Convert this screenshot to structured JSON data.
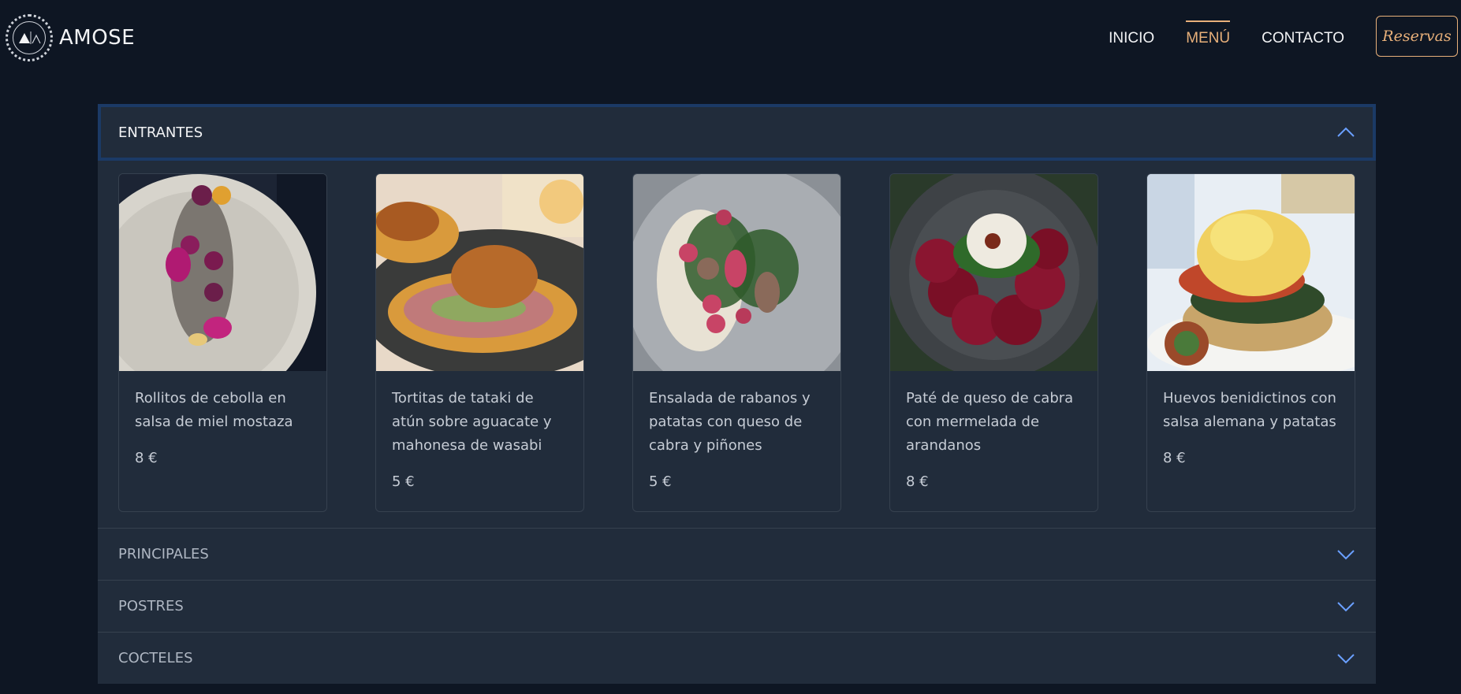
{
  "brand": {
    "name": "AMOSE"
  },
  "nav": {
    "links": [
      {
        "label": "INICIO",
        "active": false
      },
      {
        "label": "MENÚ",
        "active": true
      },
      {
        "label": "CONTACTO",
        "active": false
      }
    ],
    "reserve_label": "Reservas"
  },
  "colors": {
    "background": "#0e1623",
    "panel": "#212c3b",
    "accent": "#e8b07a",
    "chevron": "#6aa0ff",
    "focus_ring": "#1b3a66"
  },
  "menu": {
    "sections": [
      {
        "title": "ENTRANTES",
        "expanded": true,
        "items": [
          {
            "name": "Rollitos de cebolla en salsa de miel mostaza",
            "price": "8 €"
          },
          {
            "name": "Tortitas de tataki de atún sobre aguacate y mahonesa de wasabi",
            "price": "5 €"
          },
          {
            "name": "Ensalada de rabanos y patatas con queso de cabra y piñones",
            "price": "5 €"
          },
          {
            "name": "Paté de queso de cabra con mermelada de arandanos",
            "price": "8 €"
          },
          {
            "name": "Huevos benidictinos con salsa alemana y patatas",
            "price": "8 €"
          }
        ]
      },
      {
        "title": "PRINCIPALES",
        "expanded": false
      },
      {
        "title": "POSTRES",
        "expanded": false
      },
      {
        "title": "COCTELES",
        "expanded": false
      }
    ]
  }
}
